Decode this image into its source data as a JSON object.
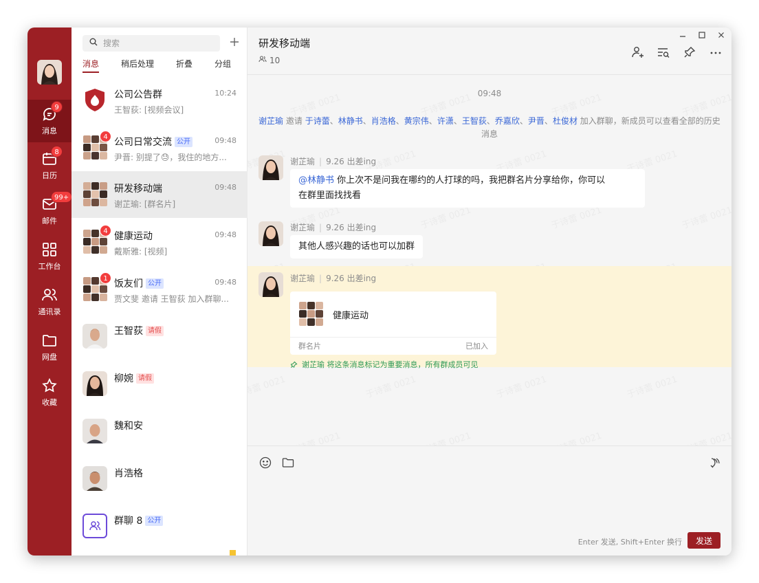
{
  "colors": {
    "brand": "#9c1f24",
    "badge": "#f23d3d",
    "link": "#3a67d6",
    "pin_green": "#2f9a5a",
    "highlight": "#fdf4d8"
  },
  "rail": {
    "items": [
      {
        "label": "消息",
        "icon": "message-icon",
        "badge": "9",
        "active": true
      },
      {
        "label": "日历",
        "icon": "calendar-icon",
        "badge": "8"
      },
      {
        "label": "邮件",
        "icon": "mail-icon",
        "badge": "99+"
      },
      {
        "label": "工作台",
        "icon": "workspace-grid-icon"
      },
      {
        "label": "通讯录",
        "icon": "contacts-icon"
      },
      {
        "label": "网盘",
        "icon": "folder-icon"
      },
      {
        "label": "收藏",
        "icon": "star-icon"
      }
    ]
  },
  "search": {
    "placeholder": "搜索"
  },
  "tabs": [
    "消息",
    "稍后处理",
    "折叠",
    "分组"
  ],
  "conversations": [
    {
      "name": "公司公告群",
      "time": "10:24",
      "preview": "王智荻: [视频会议]"
    },
    {
      "name": "公司日常交流",
      "tag": "公开",
      "time": "09:48",
      "preview": "尹晋: 别提了😓，我住的地方...",
      "badge": "4"
    },
    {
      "name": "研发移动端",
      "time": "09:48",
      "preview": "谢芷瑜: [群名片]"
    },
    {
      "name": "健康运动",
      "time": "09:48",
      "preview": "戴斯雅: [视频]",
      "badge": "4"
    },
    {
      "name": "饭友们",
      "tag": "公开",
      "time": "09:48",
      "preview": "贾文斐 邀请 王智荻 加入群聊...",
      "badge": "1"
    },
    {
      "name": "王智荻",
      "tag": "请假"
    },
    {
      "name": "柳婉",
      "tag": "请假"
    },
    {
      "name": "魏和安"
    },
    {
      "name": "肖浩格"
    },
    {
      "name": "群聊 8",
      "tag": "公开"
    }
  ],
  "chat": {
    "title": "研发移动端",
    "member_count": "10",
    "time_divider": "09:48",
    "system": {
      "inviter": "谢芷瑜",
      "invite_word": "邀请",
      "invitees": [
        "于诗蕾",
        "林静书",
        "肖浩格",
        "黄宗伟",
        "许潇",
        "王智荻",
        "乔嘉欣",
        "尹晋",
        "杜俊材"
      ],
      "separator": "、",
      "suffix_line1": "加入群聊，新成员可以查看全部的历史",
      "suffix_line2": "消息"
    },
    "messages": [
      {
        "sender": "谢芷瑜",
        "status": "9.26 出差ing",
        "mention": "@林静书",
        "text_line1": "你上次不是问我在哪约的人打球的吗，我把群名片分享给你，你可以",
        "text_line2": "在群里面找找看"
      },
      {
        "sender": "谢芷瑜",
        "status": "9.26 出差ing",
        "text": "其他人感兴趣的话也可以加群"
      },
      {
        "sender": "谢芷瑜",
        "status": "9.26 出差ing",
        "card": {
          "name": "健康运动",
          "label": "群名片",
          "status": "已加入"
        },
        "pin_note": "谢芷瑜 将这条消息标记为重要消息，所有群成员可见"
      }
    ],
    "composer": {
      "hint": "Enter 发送, Shift+Enter 换行",
      "send_label": "发送"
    }
  },
  "watermark": "于诗蕾 0021"
}
